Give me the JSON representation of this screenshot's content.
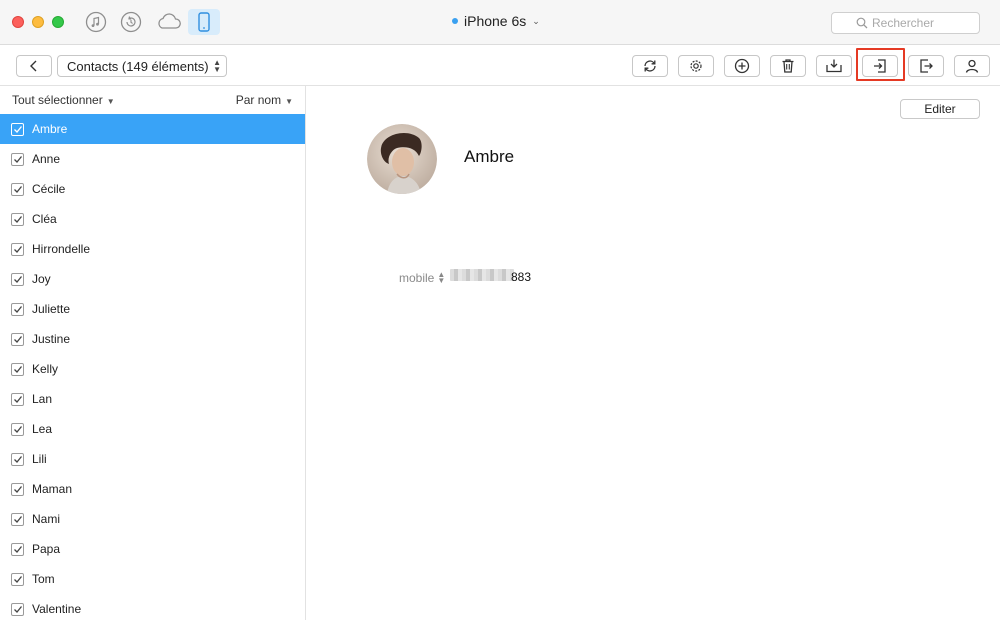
{
  "window": {
    "device_name": "iPhone 6s",
    "search_placeholder": "Rechercher"
  },
  "toolbar": {
    "category_select": "Contacts (149 éléments)"
  },
  "list": {
    "select_all_label": "Tout sélectionner",
    "sort_label": "Par nom",
    "items": [
      {
        "name": "Ambre",
        "selected": true
      },
      {
        "name": "Anne"
      },
      {
        "name": "Cécile"
      },
      {
        "name": "Cléa"
      },
      {
        "name": "Hirrondelle"
      },
      {
        "name": "Joy"
      },
      {
        "name": "Juliette"
      },
      {
        "name": "Justine"
      },
      {
        "name": "Kelly"
      },
      {
        "name": "Lan"
      },
      {
        "name": "Lea"
      },
      {
        "name": "Lili"
      },
      {
        "name": "Maman"
      },
      {
        "name": "Nami"
      },
      {
        "name": "Papa"
      },
      {
        "name": "Tom"
      },
      {
        "name": "Valentine"
      }
    ]
  },
  "detail": {
    "edit_label": "Editer",
    "contact_name": "Ambre",
    "phone_label": "mobile",
    "phone_visible_suffix": "883"
  },
  "colors": {
    "selection": "#39a3f7",
    "highlight_box": "#e53a24",
    "device_accent": "#3aa0f0"
  },
  "icons": {
    "titlebar": [
      "music-note-icon",
      "restore-icon",
      "cloud-icon",
      "iphone-icon"
    ],
    "toolbar": [
      "back-chevron-icon",
      "refresh-icon",
      "gear-icon",
      "add-circle-icon",
      "trash-icon",
      "download-to-device-icon",
      "import-icon",
      "export-icon",
      "person-icon"
    ]
  }
}
